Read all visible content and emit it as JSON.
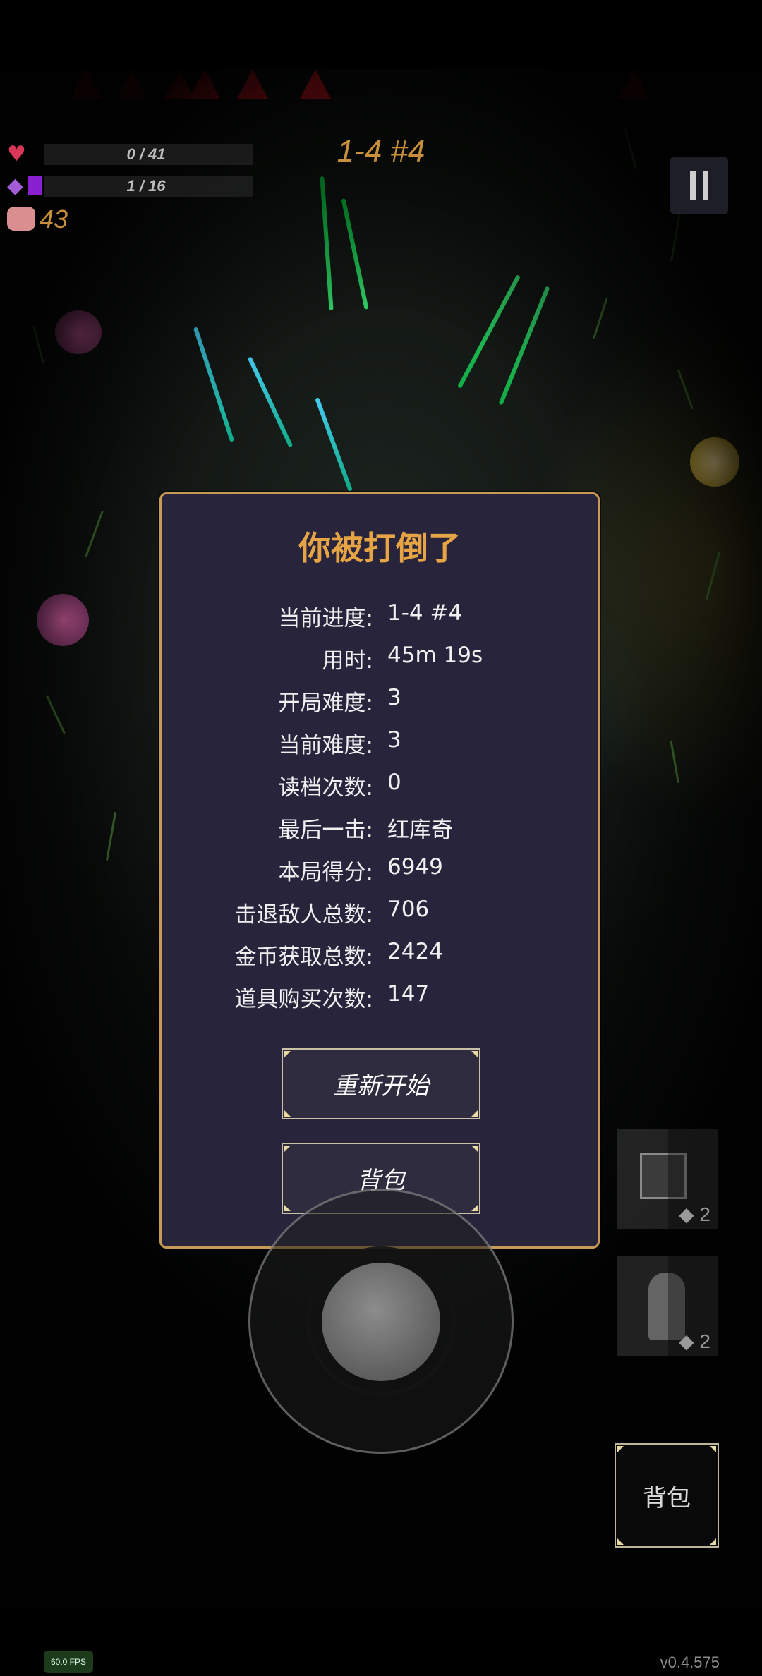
{
  "hud": {
    "health_text": "0 / 41",
    "mana_text": "1 / 16",
    "coins": "43",
    "stage": "1-4 #4",
    "icons": [
      "heart-icon",
      "mana-crystal-icon",
      "pig-coin-icon",
      "pause-icon"
    ]
  },
  "dialog": {
    "title": "你被打倒了",
    "stats": [
      {
        "label": "当前进度:",
        "value": "1-4 #4"
      },
      {
        "label": "用时:",
        "value": "45m 19s"
      },
      {
        "label": "开局难度:",
        "value": "3"
      },
      {
        "label": "当前难度:",
        "value": "3"
      },
      {
        "label": "读档次数:",
        "value": "0"
      },
      {
        "label": "最后一击:",
        "value": "红库奇"
      },
      {
        "label": "本局得分:",
        "value": "6949"
      },
      {
        "label": "击退敌人总数:",
        "value": "706"
      },
      {
        "label": "金币获取总数:",
        "value": "2424"
      },
      {
        "label": "道具购买次数:",
        "value": "147"
      }
    ],
    "restart_label": "重新开始",
    "backpack_label": "背包"
  },
  "items": {
    "slot1_count": "◆ 2",
    "slot2_count": "◆ 2"
  },
  "bag_button_label": "背包",
  "fps": "60.0 FPS",
  "version": "v0.4.575",
  "colors": {
    "accent": "#c8903a",
    "dialog_bg": "#27243c",
    "dialog_border": "#c89a55",
    "spikes": "#c8141c"
  }
}
